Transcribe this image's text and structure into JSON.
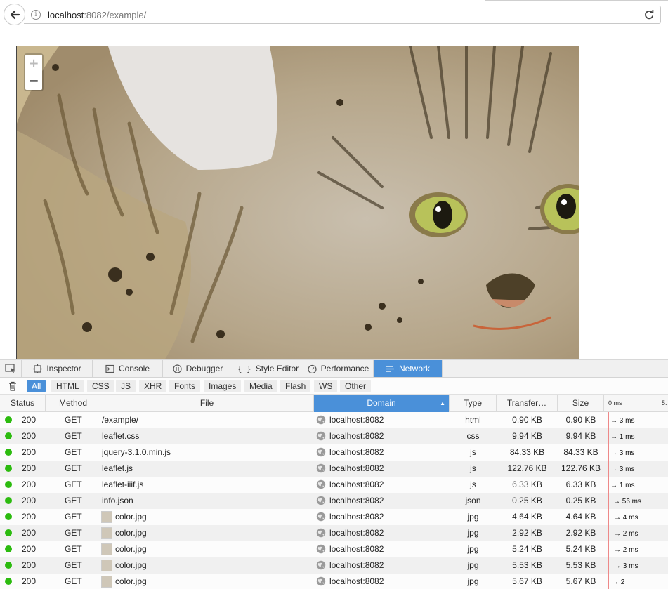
{
  "browser": {
    "url_host": "localhost",
    "url_rest": ":8082/example/"
  },
  "map": {
    "zoom_in_label": "+",
    "zoom_out_label": "−"
  },
  "devtools": {
    "tabs": [
      "Inspector",
      "Console",
      "Debugger",
      "Style Editor",
      "Performance",
      "Network"
    ],
    "active_tab": "Network",
    "filters": [
      "All",
      "HTML",
      "CSS",
      "JS",
      "XHR",
      "Fonts",
      "Images",
      "Media",
      "Flash",
      "WS",
      "Other"
    ],
    "active_filter": "All",
    "columns": {
      "status": "Status",
      "method": "Method",
      "file": "File",
      "domain": "Domain",
      "type": "Type",
      "transferred": "Transfer…",
      "size": "Size",
      "waterfall_0": "0 ms",
      "waterfall_1": "5."
    },
    "requests": [
      {
        "status": "200",
        "method": "GET",
        "file": "/example/",
        "domain": "localhost:8082",
        "type": "html",
        "transferred": "0.90 KB",
        "size": "0.90 KB",
        "timing": "→ 3 ms",
        "thumb": false
      },
      {
        "status": "200",
        "method": "GET",
        "file": "leaflet.css",
        "domain": "localhost:8082",
        "type": "css",
        "transferred": "9.94 KB",
        "size": "9.94 KB",
        "timing": "→ 1 ms",
        "thumb": false
      },
      {
        "status": "200",
        "method": "GET",
        "file": "jquery-3.1.0.min.js",
        "domain": "localhost:8082",
        "type": "js",
        "transferred": "84.33 KB",
        "size": "84.33 KB",
        "timing": "→ 3 ms",
        "thumb": false
      },
      {
        "status": "200",
        "method": "GET",
        "file": "leaflet.js",
        "domain": "localhost:8082",
        "type": "js",
        "transferred": "122.76 KB",
        "size": "122.76 KB",
        "timing": "→ 3 ms",
        "thumb": false
      },
      {
        "status": "200",
        "method": "GET",
        "file": "leaflet-iiif.js",
        "domain": "localhost:8082",
        "type": "js",
        "transferred": "6.33 KB",
        "size": "6.33 KB",
        "timing": "→ 1 ms",
        "thumb": false
      },
      {
        "status": "200",
        "method": "GET",
        "file": "info.json",
        "domain": "localhost:8082",
        "type": "json",
        "transferred": "0.25 KB",
        "size": "0.25 KB",
        "timing": "→ 56 ms",
        "thumb": false
      },
      {
        "status": "200",
        "method": "GET",
        "file": "color.jpg",
        "domain": "localhost:8082",
        "type": "jpg",
        "transferred": "4.64 KB",
        "size": "4.64 KB",
        "timing": "→ 4 ms",
        "thumb": true
      },
      {
        "status": "200",
        "method": "GET",
        "file": "color.jpg",
        "domain": "localhost:8082",
        "type": "jpg",
        "transferred": "2.92 KB",
        "size": "2.92 KB",
        "timing": "→ 2 ms",
        "thumb": true
      },
      {
        "status": "200",
        "method": "GET",
        "file": "color.jpg",
        "domain": "localhost:8082",
        "type": "jpg",
        "transferred": "5.24 KB",
        "size": "5.24 KB",
        "timing": "→ 2 ms",
        "thumb": true
      },
      {
        "status": "200",
        "method": "GET",
        "file": "color.jpg",
        "domain": "localhost:8082",
        "type": "jpg",
        "transferred": "5.53 KB",
        "size": "5.53 KB",
        "timing": "→ 3 ms",
        "thumb": true
      },
      {
        "status": "200",
        "method": "GET",
        "file": "color.jpg",
        "domain": "localhost:8082",
        "type": "jpg",
        "transferred": "5.67 KB",
        "size": "5.67 KB",
        "timing": "→ 2",
        "thumb": true
      }
    ]
  }
}
